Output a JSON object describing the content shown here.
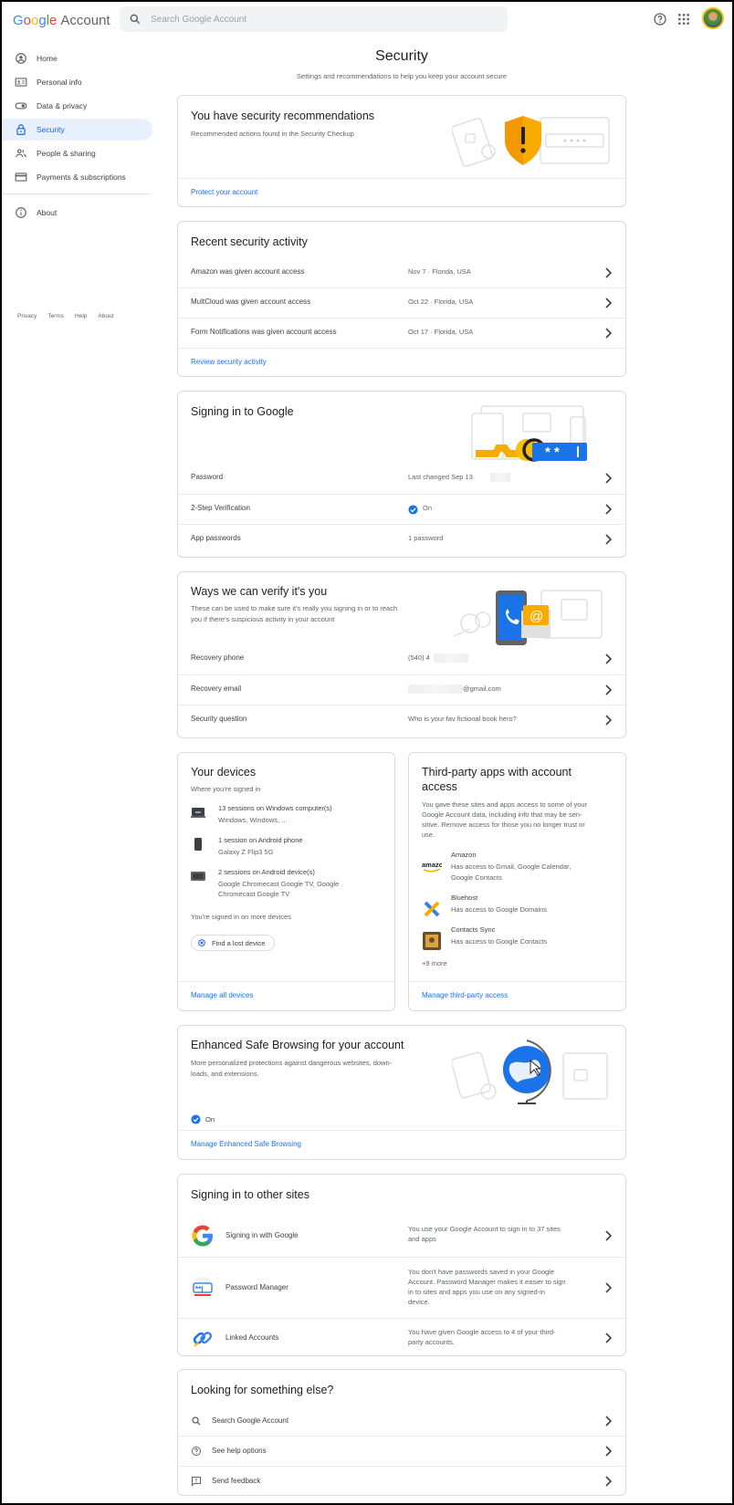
{
  "header": {
    "brand_word": "Google",
    "product": "Account",
    "search_placeholder": "Search Google Account"
  },
  "icons": {
    "search": "search-icon",
    "help": "help-circle-icon",
    "apps": "apps-grid-icon",
    "chevron": "chevron-right-icon"
  },
  "sidebar": {
    "items": [
      {
        "label": "Home",
        "icon": "home-account-icon"
      },
      {
        "label": "Personal info",
        "icon": "id-card-icon"
      },
      {
        "label": "Data & privacy",
        "icon": "toggle-icon"
      },
      {
        "label": "Security",
        "icon": "lock-icon",
        "active": true
      },
      {
        "label": "People & sharing",
        "icon": "people-icon"
      },
      {
        "label": "Payments & subscriptions",
        "icon": "credit-card-icon"
      }
    ],
    "about": "About",
    "footer": [
      "Privacy",
      "Terms",
      "Help",
      "About"
    ]
  },
  "page": {
    "title": "Security",
    "subtitle": "Settings and recommendations to help you keep your account secure"
  },
  "recommendations": {
    "title": "You have security recommendations",
    "desc": "Recommended actions found in the Security Checkup",
    "link": "Protect your account"
  },
  "recent_activity": {
    "title": "Recent security activity",
    "rows": [
      {
        "label": "Amazon was given account access",
        "value": "Nov 7 · Florida, USA"
      },
      {
        "label": "MultCloud was given account access",
        "value": "Oct 22 · Florida, USA"
      },
      {
        "label": "Form Notifications was given account access",
        "value": "Oct 17 · Florida, USA"
      }
    ],
    "link": "Review security activity"
  },
  "signing_in": {
    "title": "Signing in to Google",
    "rows": [
      {
        "label": "Password",
        "value": "Last changed Sep 13"
      },
      {
        "label": "2-Step Verification",
        "value": "On"
      },
      {
        "label": "App passwords",
        "value": "1 password"
      }
    ]
  },
  "verify": {
    "title": "Ways we can verify it's you",
    "desc_line1": "These can be used to make sure it's really you signing in or to reach",
    "desc_line2": "you if there's suspicious activity in your account",
    "rows": [
      {
        "label": "Recovery phone",
        "value": "(540) 4"
      },
      {
        "label": "Recovery email",
        "value": "@gmail.com"
      },
      {
        "label": "Security question",
        "value": "Who is your fav fictional book hero?"
      }
    ]
  },
  "devices": {
    "title": "Your devices",
    "subtitle": "Where you're signed in",
    "items": [
      {
        "title": "13 sessions on Windows computer(s)",
        "detail": "Windows, Windows, ...",
        "icon": "laptop-icon"
      },
      {
        "title": "1 session on Android phone",
        "detail": "Galaxy Z Flip3 5G",
        "icon": "phone-icon"
      },
      {
        "title": "2 sessions on Android device(s)",
        "detail": "Google Chromecast Google TV, Google Chromecast Google TV",
        "icon": "tv-device-icon"
      }
    ],
    "more": "You're signed in on more devices",
    "find_button": "Find a lost device",
    "link": "Manage all devices"
  },
  "third_party": {
    "title_line1": "Third-party apps with account",
    "title_line2": "access",
    "desc_lines": [
      "You gave these sites and apps access to some of your",
      "Google Account data, including info that may be sen-",
      "sitive. Remove access for those you no longer trust or",
      "use."
    ],
    "apps": [
      {
        "name": "Amazon",
        "line1": "Has access to Gmail, Google Calendar,",
        "line2": "Google Contacts",
        "icon": "amazon-logo-icon"
      },
      {
        "name": "Bluehost",
        "line1": "Has access to Google Domains",
        "line2": "",
        "icon": "bluehost-logo-icon"
      },
      {
        "name": "Contacts Sync",
        "line1": "Has access to Google Contacts",
        "line2": "",
        "icon": "contacts-sync-icon"
      }
    ],
    "more": "+9 more",
    "link": "Manage third-party access"
  },
  "safe_browsing": {
    "title": "Enhanced Safe Browsing for your account",
    "desc_line1": "More personalized protections against dangerous websites, down-",
    "desc_line2": "loads, and extensions.",
    "status": "On",
    "link": "Manage Enhanced Safe Browsing"
  },
  "other_sites": {
    "title": "Signing in to other sites",
    "rows": [
      {
        "label": "Signing in with Google",
        "lines": [
          "You use your Google Account to sign in to 37 sites",
          "and apps"
        ],
        "icon": "google-g-icon"
      },
      {
        "label": "Password Manager",
        "lines": [
          "You don't have passwords saved in your Google",
          "Account. Password Manager makes it easier to sign",
          "in to sites and apps you use on any signed-in",
          "device."
        ],
        "icon": "password-manager-icon"
      },
      {
        "label": "Linked Accounts",
        "lines": [
          "You have given Google access to 4 of your third-",
          "party accounts."
        ],
        "icon": "linked-accounts-icon"
      }
    ]
  },
  "help": {
    "title": "Looking for something else?",
    "rows": [
      {
        "label": "Search Google Account",
        "icon": "search-icon"
      },
      {
        "label": "See help options",
        "icon": "help-circle-icon"
      },
      {
        "label": "Send feedback",
        "icon": "feedback-icon"
      }
    ]
  },
  "colors": {
    "accent": "#1a73e8",
    "active_bg": "#e8f0fe",
    "warning": "#f9ab00",
    "border": "#dadce0"
  }
}
